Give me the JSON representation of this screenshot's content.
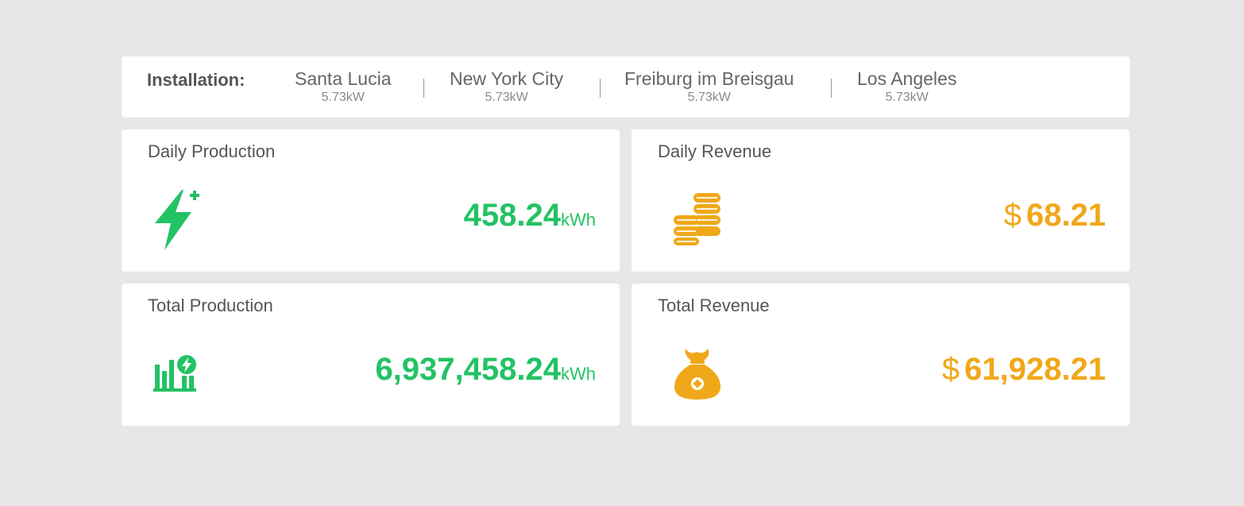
{
  "installation": {
    "label": "Installation:",
    "sites": [
      {
        "name": "Santa Lucia",
        "power": "5.73kW"
      },
      {
        "name": "New York City",
        "power": "5.73kW"
      },
      {
        "name": "Freiburg im Breisgau",
        "power": "5.73kW"
      },
      {
        "name": "Los Angeles",
        "power": "5.73kW"
      }
    ]
  },
  "cards": {
    "daily_production": {
      "title": "Daily Production",
      "value": "458.24",
      "unit": "kWh",
      "icon": "lightning-plus-icon"
    },
    "daily_revenue": {
      "title": "Daily Revenue",
      "currency": "$",
      "value": "68.21",
      "icon": "coins-icon"
    },
    "total_production": {
      "title": "Total Production",
      "value": "6,937,458.24",
      "unit": "kWh",
      "icon": "bar-chart-bolt-icon"
    },
    "total_revenue": {
      "title": "Total Revenue",
      "currency": "$",
      "value": "61,928.21",
      "icon": "money-bag-icon"
    }
  },
  "colors": {
    "production": "#23c265",
    "revenue": "#f0a81a",
    "background": "#e7e7e7"
  }
}
